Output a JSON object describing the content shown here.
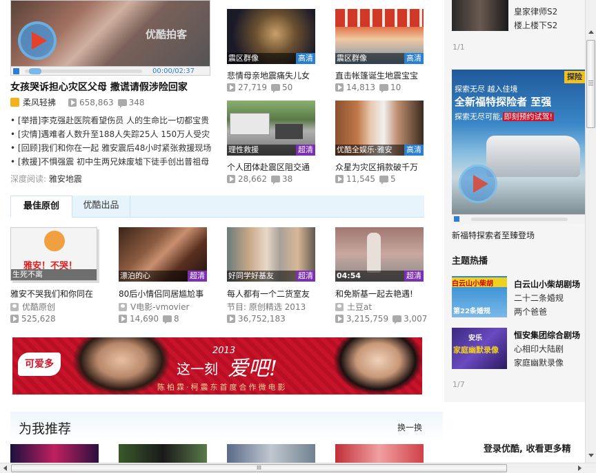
{
  "main_video": {
    "title": "女孩哭诉担心灾区父母 撒谎请假涉险回家",
    "uploader": "柔风轻拂",
    "plays": "658,863",
    "comments": "348",
    "time": "00:00/02:37",
    "watermark": "优酷拍客"
  },
  "news": [
    {
      "tag": "[举措]",
      "text": "李克强赴医院看望伤员 人的生命比一切都宝贵"
    },
    {
      "tag": "[灾情]",
      "text": "遇难者人数升至188人失踪25人 150万人受灾"
    },
    {
      "tag": "[回顾]",
      "text": "我们和你在一起 雅安震后48小时紧张救援现场"
    },
    {
      "tag": "[救援]",
      "text": "不惧强震 初中生两兄妹废墟下徒手创出普祖母"
    }
  ],
  "deep_read": {
    "label": "深度阅读:",
    "link": "雅安地震"
  },
  "top_grid": [
    {
      "caption": "震区群像",
      "badge": "高清",
      "title": "悲情母亲地震痛失儿女",
      "plays": "27,719",
      "comments": "50"
    },
    {
      "caption": "震区群像",
      "badge": "高清",
      "title": "直击帐篷诞生地震宝宝",
      "plays": "14,813",
      "comments": "10"
    },
    {
      "caption": "理性救援",
      "badge": "超清",
      "title": "个人团体赴震区阻交通",
      "plays": "28,662",
      "comments": "38"
    },
    {
      "caption": "优酷全娱乐·雅安",
      "badge": "高清",
      "title": "众星为灾区捐款破千万",
      "plays": "11,545",
      "comments": "5"
    }
  ],
  "tabs": [
    "最佳原创",
    "优酷出品"
  ],
  "originals": [
    {
      "caption": "生死不离",
      "thumb_text": "雅安！不哭！",
      "badge": "",
      "title": "雅安不哭我们和你同在",
      "source": "优酷原创",
      "plays": "525,628",
      "comments": ""
    },
    {
      "caption": "漂泊的心",
      "badge": "超清",
      "title": "80后小情侣同居尴尬事",
      "source": "V电影-vmovier",
      "plays": "14,690",
      "comments": "8"
    },
    {
      "caption": "好同学好基友",
      "badge": "超清",
      "title": "每人都有一个二货室友",
      "source": "节目: 原创精选 2013",
      "plays": "36,752,183",
      "comments": ""
    },
    {
      "caption": "04:54",
      "badge": "超清",
      "title": "和免斯基一起去艳遇!",
      "source": "土豆at",
      "plays": "3,215,759",
      "comments": "3,007"
    }
  ],
  "banner": {
    "brand": "可爱多",
    "year": "2013",
    "slogan": "这一刻",
    "love": "爱吧!",
    "subtitle": "陈柏霖·柯震东首度合作微电影"
  },
  "recommend": {
    "title": "为我推荐",
    "refresh": "换一换"
  },
  "sidebar": {
    "top_items": [
      "皇家律师S2",
      "楼上楼下S2"
    ],
    "top_page": "1/1",
    "ad": {
      "slogan1": "探索无尽 越入佳境",
      "slogan2": "全新福特探险者 至强",
      "slogan3": "探索无尽可能,",
      "slogan3b": "即刻预约试驾!",
      "corner": "探险",
      "caption": "新福特探索者至臻登场"
    },
    "section_title": "主题热播",
    "themes": [
      {
        "title": "白云山小柴胡剧场",
        "items": [
          "二十二条婚规",
          "两个爸爸"
        ],
        "thumb_text": "白云山小柴胡",
        "thumb_sub": "第22条婚规"
      },
      {
        "title": "恒安集团综合剧场",
        "items": [
          "心相印大陆剧",
          "家庭幽默录像"
        ],
        "thumb_text": "家庭幽默录像",
        "thumb_sub": "安乐"
      }
    ],
    "theme_page": "1/7",
    "login_text": "登录优酷, 收看更多精"
  },
  "scrollbar": {
    "grip": "III"
  },
  "colors": {
    "accent": "#2a7fd0",
    "purple": "#7b2fb2",
    "banner_red": "#c8142a"
  }
}
